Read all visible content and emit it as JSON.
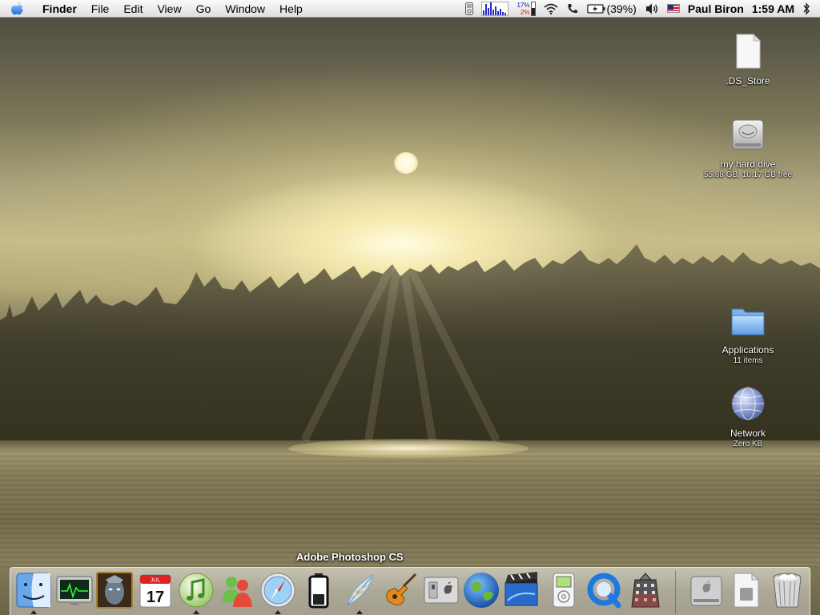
{
  "menubar": {
    "app_name": "Finder",
    "menus": [
      "File",
      "Edit",
      "View",
      "Go",
      "Window",
      "Help"
    ],
    "cpu_percent": "17%",
    "mem_percent": "2%",
    "battery_percent": "(39%)",
    "user_name": "Paul Biron",
    "clock": "1:59 AM"
  },
  "desktop_icons": [
    {
      "label": ".DS_Store",
      "sub": "",
      "icon": "document-icon"
    },
    {
      "label": "my hard dive",
      "sub": "55.88 GB, 10.17 GB free",
      "icon": "hard-drive-icon"
    },
    {
      "label": "Applications",
      "sub": "11 items",
      "icon": "folder-icon"
    },
    {
      "label": "Network",
      "sub": "Zero KB",
      "icon": "network-globe-icon"
    }
  ],
  "dock": {
    "tooltip": "Adobe Photoshop CS",
    "apps": [
      {
        "name": "finder-icon",
        "running": true
      },
      {
        "name": "activity-monitor-icon",
        "running": false
      },
      {
        "name": "warcraft-icon",
        "running": false
      },
      {
        "name": "ical-icon",
        "running": false,
        "date_text": "17",
        "month_text": "JUL"
      },
      {
        "name": "itunes-icon",
        "running": true
      },
      {
        "name": "msn-messenger-icon",
        "running": false
      },
      {
        "name": "safari-icon",
        "running": true
      },
      {
        "name": "battery-app-icon",
        "running": false
      },
      {
        "name": "photoshop-feather-icon",
        "running": true
      },
      {
        "name": "garageband-icon",
        "running": false
      },
      {
        "name": "system-preferences-icon",
        "running": false
      },
      {
        "name": "google-earth-icon",
        "running": false
      },
      {
        "name": "imovie-icon",
        "running": false
      },
      {
        "name": "ipod-utility-icon",
        "running": false
      },
      {
        "name": "quicktime-icon",
        "running": false
      },
      {
        "name": "server-building-icon",
        "running": false
      }
    ],
    "docs": [
      {
        "name": "drive-stack-icon"
      },
      {
        "name": "document-stack-icon"
      },
      {
        "name": "trash-icon"
      }
    ]
  }
}
